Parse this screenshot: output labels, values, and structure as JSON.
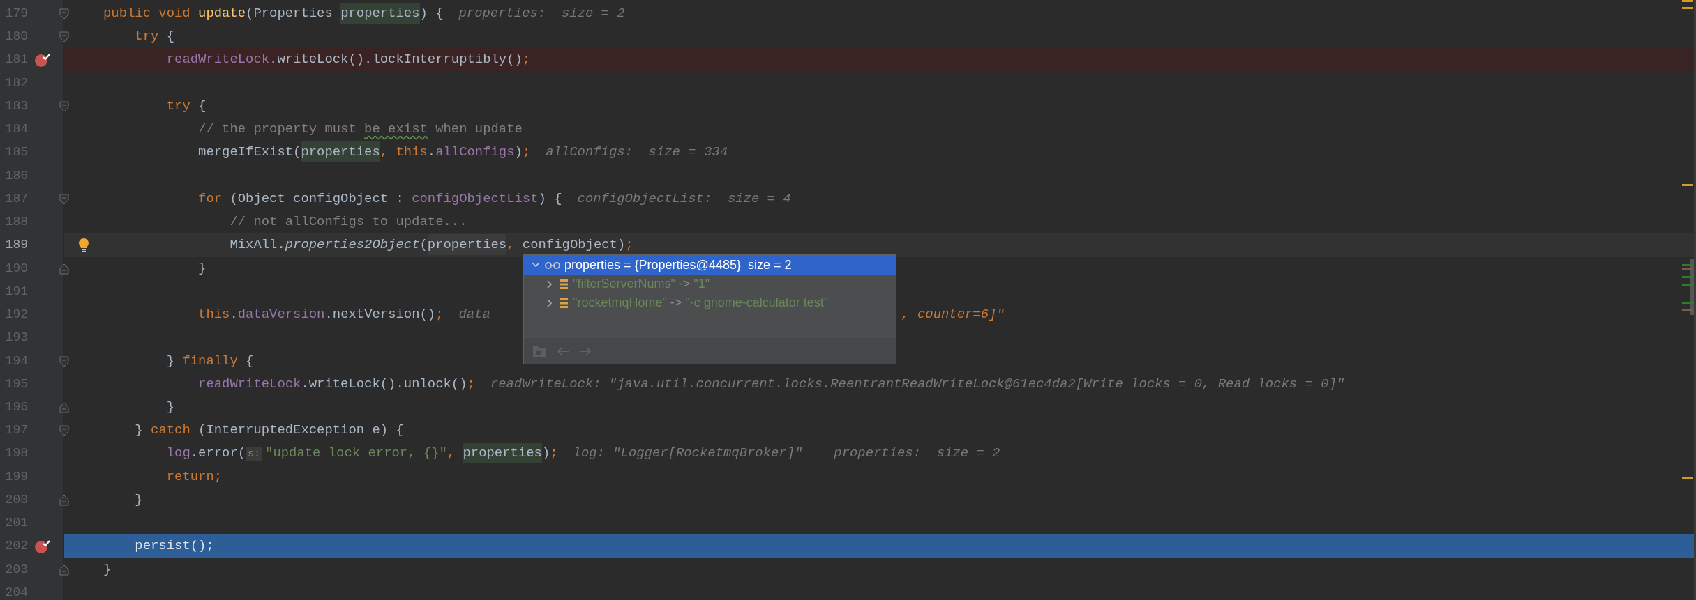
{
  "editor": {
    "lines": [
      {
        "number": "179",
        "fold_start": true,
        "tokens": [
          {
            "kind": "keyword",
            "text": "public void "
          },
          {
            "kind": "method",
            "text": "update"
          },
          {
            "kind": "plain",
            "text": "(Properties "
          },
          {
            "kind": "usage",
            "text": "properties"
          },
          {
            "kind": "plain",
            "text": ") {"
          }
        ],
        "hints": [
          {
            "kind": "value",
            "text": "properties:  size = 2"
          }
        ]
      },
      {
        "number": "180",
        "fold_start": true,
        "tokens": [
          {
            "kind": "keyword",
            "text": "    try"
          },
          {
            "kind": "plain",
            "text": " {"
          }
        ]
      },
      {
        "number": "181",
        "breakpoint": true,
        "tokens": [
          {
            "kind": "field",
            "text": "        readWriteLock"
          },
          {
            "kind": "plain",
            "text": ".writeLock().lockInterruptibly()"
          },
          {
            "kind": "keyword",
            "text": ";"
          }
        ]
      },
      {
        "number": "182"
      },
      {
        "number": "183",
        "fold_start": true,
        "tokens": [
          {
            "kind": "keyword",
            "text": "        try"
          },
          {
            "kind": "plain",
            "text": " {"
          }
        ]
      },
      {
        "number": "184",
        "tokens": [
          {
            "kind": "comment",
            "text": "            // the property must "
          },
          {
            "kind": "typo",
            "text": "be exist"
          },
          {
            "kind": "comment",
            "text": " when update"
          }
        ]
      },
      {
        "number": "185",
        "tokens": [
          {
            "kind": "plain",
            "text": "            mergeIfExist("
          },
          {
            "kind": "usage",
            "text": "properties"
          },
          {
            "kind": "keyword",
            "text": ", this"
          },
          {
            "kind": "plain",
            "text": "."
          },
          {
            "kind": "field",
            "text": "allConfigs"
          },
          {
            "kind": "plain",
            "text": ")"
          },
          {
            "kind": "keyword",
            "text": ";"
          }
        ],
        "hints": [
          {
            "kind": "value",
            "text": "allConfigs:  size = 334"
          }
        ]
      },
      {
        "number": "186"
      },
      {
        "number": "187",
        "fold_start": true,
        "tokens": [
          {
            "kind": "keyword",
            "text": "            for"
          },
          {
            "kind": "plain",
            "text": " (Object configObject : "
          },
          {
            "kind": "field",
            "text": "configObjectList"
          },
          {
            "kind": "plain",
            "text": ") {"
          }
        ],
        "hints": [
          {
            "kind": "value",
            "text": "configObjectList:  size = 4"
          }
        ]
      },
      {
        "number": "188",
        "tokens": [
          {
            "kind": "comment",
            "text": "                // not allConfigs to update..."
          }
        ]
      },
      {
        "number": "189",
        "intention": true,
        "caret": true,
        "tokens": [
          {
            "kind": "plain",
            "text": "                MixAll."
          },
          {
            "kind": "static-call",
            "text": "properties2Object"
          },
          {
            "kind": "plain",
            "text": "("
          },
          {
            "kind": "caret-usage",
            "text": "properties"
          },
          {
            "kind": "keyword",
            "text": ","
          },
          {
            "kind": "plain",
            "text": " configObject)"
          },
          {
            "kind": "keyword",
            "text": ";"
          }
        ]
      },
      {
        "number": "190",
        "fold_end": true,
        "tokens": [
          {
            "kind": "plain",
            "text": "            }"
          }
        ]
      },
      {
        "number": "191"
      },
      {
        "number": "192",
        "tokens": [
          {
            "kind": "keyword",
            "text": "            this"
          },
          {
            "kind": "plain",
            "text": "."
          },
          {
            "kind": "field",
            "text": "dataVersion"
          },
          {
            "kind": "plain",
            "text": ".nextVersion()"
          },
          {
            "kind": "keyword",
            "text": ";"
          }
        ],
        "hints": [
          {
            "kind": "value",
            "text": "data"
          },
          {
            "kind": "changed",
            "text": ", counter=6]\""
          }
        ]
      },
      {
        "number": "193"
      },
      {
        "number": "194",
        "fold_start": true,
        "tokens": [
          {
            "kind": "plain",
            "text": "        } "
          },
          {
            "kind": "keyword",
            "text": "finally"
          },
          {
            "kind": "plain",
            "text": " {"
          }
        ]
      },
      {
        "number": "195",
        "tokens": [
          {
            "kind": "field",
            "text": "            readWriteLock"
          },
          {
            "kind": "plain",
            "text": ".writeLock().unlock()"
          },
          {
            "kind": "keyword",
            "text": ";"
          }
        ],
        "hints": [
          {
            "kind": "value",
            "text": "readWriteLock: \"java.util.concurrent.locks.ReentrantReadWriteLock@61ec4da2[Write locks = 0, Read locks = 0]\""
          }
        ]
      },
      {
        "number": "196",
        "fold_end": true,
        "tokens": [
          {
            "kind": "plain",
            "text": "        }"
          }
        ]
      },
      {
        "number": "197",
        "fold_start": true,
        "tokens": [
          {
            "kind": "plain",
            "text": "    } "
          },
          {
            "kind": "keyword",
            "text": "catch"
          },
          {
            "kind": "plain",
            "text": " (InterruptedException e) {"
          }
        ]
      },
      {
        "number": "198",
        "tokens": [
          {
            "kind": "field",
            "text": "        log"
          },
          {
            "kind": "plain",
            "text": ".error("
          },
          {
            "kind": "param-hint",
            "text": "s:"
          },
          {
            "kind": "string",
            "text": "\"update lock error, {}\""
          },
          {
            "kind": "keyword",
            "text": ", "
          },
          {
            "kind": "usage",
            "text": "properties"
          },
          {
            "kind": "plain",
            "text": ")"
          },
          {
            "kind": "keyword",
            "text": ";"
          }
        ],
        "hints": [
          {
            "kind": "value",
            "text": "log: \"Logger[RocketmqBroker]\""
          },
          {
            "kind": "value",
            "text": "properties:  size = 2"
          }
        ]
      },
      {
        "number": "199",
        "tokens": [
          {
            "kind": "keyword",
            "text": "        return;"
          }
        ]
      },
      {
        "number": "200",
        "fold_end": true,
        "tokens": [
          {
            "kind": "plain",
            "text": "    }"
          }
        ]
      },
      {
        "number": "201"
      },
      {
        "number": "202",
        "breakpoint": true,
        "execution": true,
        "tokens": [
          {
            "kind": "plain",
            "text": "    persist()"
          },
          {
            "kind": "keyword",
            "text": ";"
          }
        ]
      },
      {
        "number": "203",
        "fold_end": true,
        "tokens": [
          {
            "kind": "plain",
            "text": "}"
          }
        ]
      },
      {
        "number": "204"
      }
    ]
  },
  "popup": {
    "root": {
      "label": "properties = {Properties@4485}  size = 2",
      "expanded": true,
      "selected": true,
      "children": [
        {
          "key": "\"filterServerNums\"",
          "arrow": "->",
          "value": "\"1\"",
          "expanded": false,
          "selected": false
        },
        {
          "key": "\"rocketmqHome\"",
          "arrow": "->",
          "value": "\"-c gnome-calculator test\"",
          "expanded": false,
          "selected": false
        }
      ]
    }
  }
}
